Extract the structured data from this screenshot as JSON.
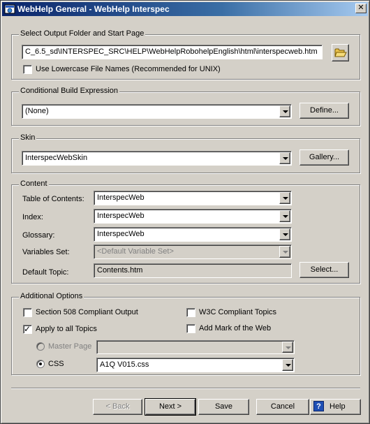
{
  "window": {
    "title": "WebHelp General - WebHelp Interspec",
    "close_glyph": "✕"
  },
  "output": {
    "group_label": "Select Output Folder and Start Page",
    "path_value": "C_6.5_sd\\INTERSPEC_SRC\\HELP\\WebHelpRobohelpEnglish\\html\\interspecweb.htm",
    "lowercase_label": "Use Lowercase File Names (Recommended for UNIX)",
    "lowercase_checked": false
  },
  "conditional": {
    "group_label": "Conditional Build Expression",
    "value": "(None)",
    "define_button": "Define..."
  },
  "skin": {
    "group_label": "Skin",
    "value": "InterspecWebSkin",
    "gallery_button": "Gallery..."
  },
  "content": {
    "group_label": "Content",
    "toc_label": "Table of Contents:",
    "toc_value": "InterspecWeb",
    "index_label": "Index:",
    "index_value": "InterspecWeb",
    "glossary_label": "Glossary:",
    "glossary_value": "InterspecWeb",
    "variables_label": "Variables Set:",
    "variables_value": "<Default Variable Set>",
    "default_topic_label": "Default Topic:",
    "default_topic_value": "Contents.htm",
    "select_button": "Select..."
  },
  "options": {
    "group_label": "Additional Options",
    "section508_label": "Section 508 Compliant Output",
    "section508_checked": false,
    "w3c_label": "W3C Compliant Topics",
    "w3c_checked": false,
    "apply_all_label": "Apply to all Topics",
    "apply_all_checked": true,
    "mark_web_label": "Add Mark of the Web",
    "mark_web_checked": false,
    "master_page_label": "Master Page",
    "master_page_value": "",
    "css_label": "CSS",
    "css_value": "A1Q V015.css",
    "css_selected": true
  },
  "footer": {
    "back_button": "< Back",
    "next_button": "Next >",
    "save_button": "Save",
    "cancel_button": "Cancel",
    "help_button": "Help",
    "help_icon_glyph": "?"
  },
  "colors": {
    "dialog_face": "#d4d0c8",
    "title_gradient_start": "#0a246a",
    "title_gradient_end": "#a6caf0",
    "help_icon": "#1f4fb4",
    "folder_icon": "#e8c04a"
  }
}
